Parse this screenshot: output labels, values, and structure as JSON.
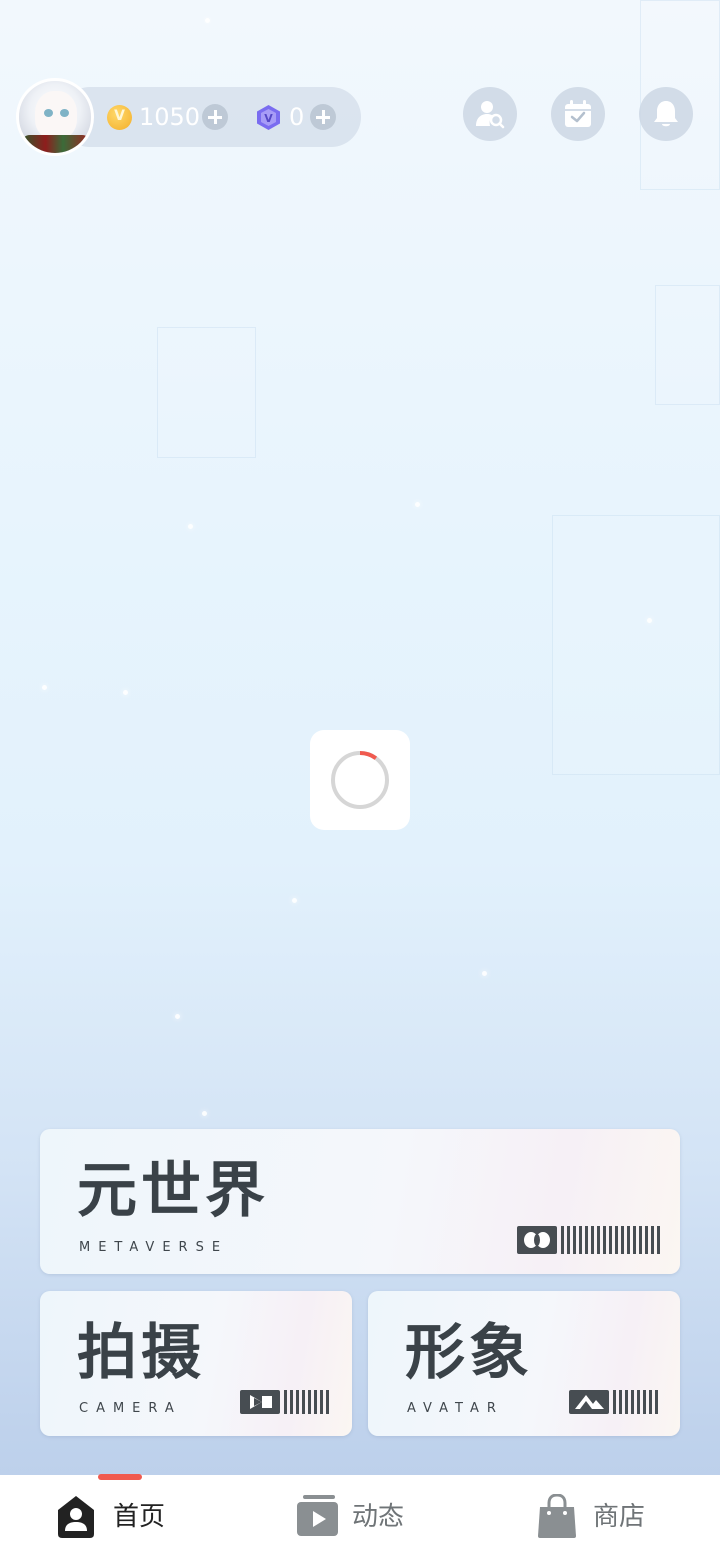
{
  "header": {
    "coins": {
      "icon": "gold-coin-icon",
      "value": "1050",
      "accent": "#f3ae2a"
    },
    "gems": {
      "icon": "purple-gem-icon",
      "value": "0",
      "accent": "#7a6cf0"
    },
    "actions": [
      {
        "icon": "find-friend-icon"
      },
      {
        "icon": "calendar-check-icon"
      },
      {
        "icon": "bell-icon"
      }
    ]
  },
  "loading": {
    "icon": "loading-spinner-icon",
    "accent": "#f05a4f",
    "progress": 0.1
  },
  "cards": {
    "metaverse": {
      "title": "元世界",
      "subtitle": "METAVERSE",
      "icon": "vr-goggles-icon"
    },
    "camera": {
      "title": "拍摄",
      "subtitle": "CAMERA",
      "icon": "video-camera-icon"
    },
    "avatar": {
      "title": "形象",
      "subtitle": "AVATAR",
      "icon": "mountain-image-icon"
    }
  },
  "nav": {
    "items": [
      {
        "label": "首页",
        "icon": "home-person-icon",
        "active": true
      },
      {
        "label": "动态",
        "icon": "video-feed-icon",
        "active": false
      },
      {
        "label": "商店",
        "icon": "shopping-bag-icon",
        "active": false
      }
    ],
    "active_color": "#222222",
    "inactive_color": "#6f7477",
    "indicator_color": "#f05a4f"
  }
}
